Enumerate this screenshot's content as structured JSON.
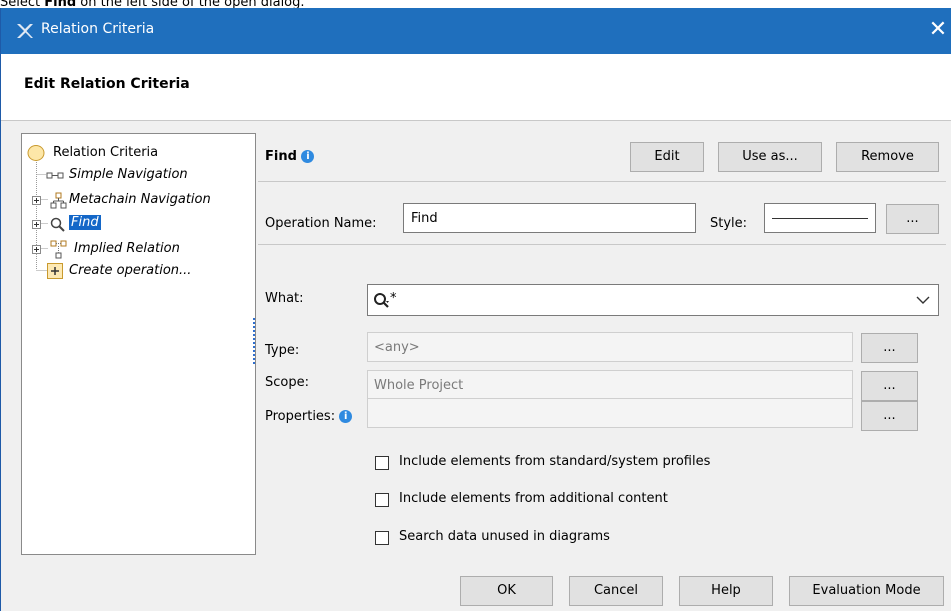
{
  "caption": {
    "prefix": "Select ",
    "bold": "Find",
    "suffix": " on the left side of the open dialog."
  },
  "window": {
    "title": "Relation Criteria",
    "close": "✕"
  },
  "header": {
    "title": "Edit Relation Criteria"
  },
  "tree": {
    "root": "Relation Criteria",
    "items": [
      {
        "label": "Simple Navigation"
      },
      {
        "label": "Metachain Navigation"
      },
      {
        "label": "Find"
      },
      {
        "label": "Implied Relation"
      },
      {
        "label": "Create operation..."
      }
    ]
  },
  "panel": {
    "title": "Find",
    "buttons": {
      "edit": "Edit",
      "use_as": "Use as...",
      "remove": "Remove"
    },
    "operation_name_label": "Operation Name:",
    "operation_name_value": "Find",
    "style_label": "Style:",
    "style_button": "...",
    "what_label": "What:",
    "what_value": "*",
    "type_label": "Type:",
    "type_value": "<any>",
    "scope_label": "Scope:",
    "scope_value": "Whole Project",
    "properties_label": "Properties:",
    "properties_value": "",
    "dots": "...",
    "checkboxes": [
      {
        "label": "Include elements from standard/system profiles",
        "checked": false
      },
      {
        "label": "Include elements from additional content",
        "checked": false
      },
      {
        "label": "Search data unused in diagrams",
        "checked": false
      }
    ]
  },
  "footer": {
    "ok": "OK",
    "cancel": "Cancel",
    "help": "Help",
    "evaluation": "Evaluation Mode"
  },
  "colors": {
    "titlebar": "#1f6fbd",
    "selection": "#1467c8",
    "info": "#2f8ae0"
  }
}
